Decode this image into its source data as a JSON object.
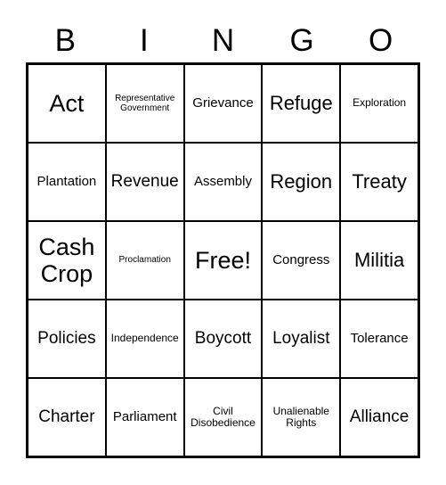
{
  "card": {
    "header_letters": [
      "B",
      "I",
      "N",
      "G",
      "O"
    ],
    "free_space_label": "Free!",
    "rows": [
      [
        {
          "label": "Act",
          "size": "xl"
        },
        {
          "label": "Representative Government",
          "size": "xxs"
        },
        {
          "label": "Grievance",
          "size": "sm"
        },
        {
          "label": "Refuge",
          "size": "lg"
        },
        {
          "label": "Exploration",
          "size": "xs"
        }
      ],
      [
        {
          "label": "Plantation",
          "size": "sm"
        },
        {
          "label": "Revenue",
          "size": "md"
        },
        {
          "label": "Assembly",
          "size": "sm"
        },
        {
          "label": "Region",
          "size": "lg"
        },
        {
          "label": "Treaty",
          "size": "lg"
        }
      ],
      [
        {
          "label": "Cash Crop",
          "size": "xl"
        },
        {
          "label": "Proclamation",
          "size": "xxs"
        },
        {
          "label": "Free!",
          "size": "xl"
        },
        {
          "label": "Congress",
          "size": "sm"
        },
        {
          "label": "Militia",
          "size": "lg"
        }
      ],
      [
        {
          "label": "Policies",
          "size": "md"
        },
        {
          "label": "Independence",
          "size": "xs"
        },
        {
          "label": "Boycott",
          "size": "md"
        },
        {
          "label": "Loyalist",
          "size": "md"
        },
        {
          "label": "Tolerance",
          "size": "sm"
        }
      ],
      [
        {
          "label": "Charter",
          "size": "md"
        },
        {
          "label": "Parliament",
          "size": "sm"
        },
        {
          "label": "Civil Disobedience",
          "size": "xs"
        },
        {
          "label": "Unalienable Rights",
          "size": "xs"
        },
        {
          "label": "Alliance",
          "size": "md"
        }
      ]
    ]
  },
  "colors": {
    "background": "#ffffff",
    "text": "#000000",
    "grid_line": "#000000"
  }
}
